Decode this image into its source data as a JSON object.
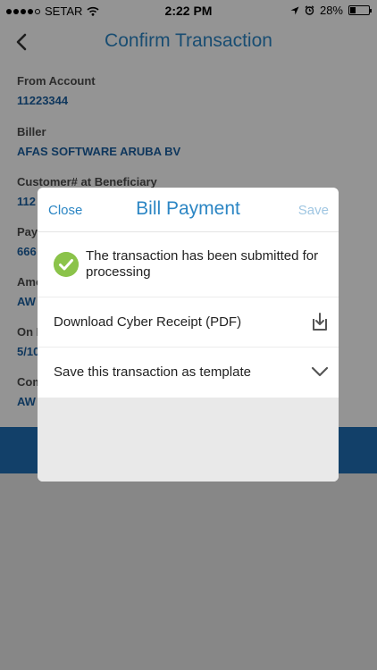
{
  "status_bar": {
    "carrier": "SETAR",
    "time": "2:22 PM",
    "battery": "28%",
    "battery_level": 0.28,
    "signal_bars": 4
  },
  "nav": {
    "title": "Confirm Transaction",
    "back_icon": "chevron-left-icon"
  },
  "form": {
    "fields": [
      {
        "label": "From Account",
        "value": "11223344"
      },
      {
        "label": "Biller",
        "value": "AFAS SOFTWARE ARUBA BV"
      },
      {
        "label": "Customer# at Beneficiary",
        "value": "112"
      },
      {
        "label": "Pay",
        "value": "666"
      },
      {
        "label": "Amo",
        "value": "AW"
      },
      {
        "label": "On D",
        "value": "5/10"
      },
      {
        "label": "Com",
        "value": "AW"
      }
    ]
  },
  "modal": {
    "close_label": "Close",
    "title": "Bill Payment",
    "save_label": "Save",
    "success_message": "The transaction has been submitted for processing",
    "success_icon": "check-circle-icon",
    "receipt_label": "Download Cyber Receipt (PDF)",
    "receipt_icon": "download-icon",
    "template_label": "Save this transaction as template",
    "template_icon": "chevron-down-icon"
  },
  "colors": {
    "accent": "#2c86c4",
    "value_text": "#1a5fa0",
    "success": "#8bc34a",
    "band": "#1f6fb5"
  }
}
